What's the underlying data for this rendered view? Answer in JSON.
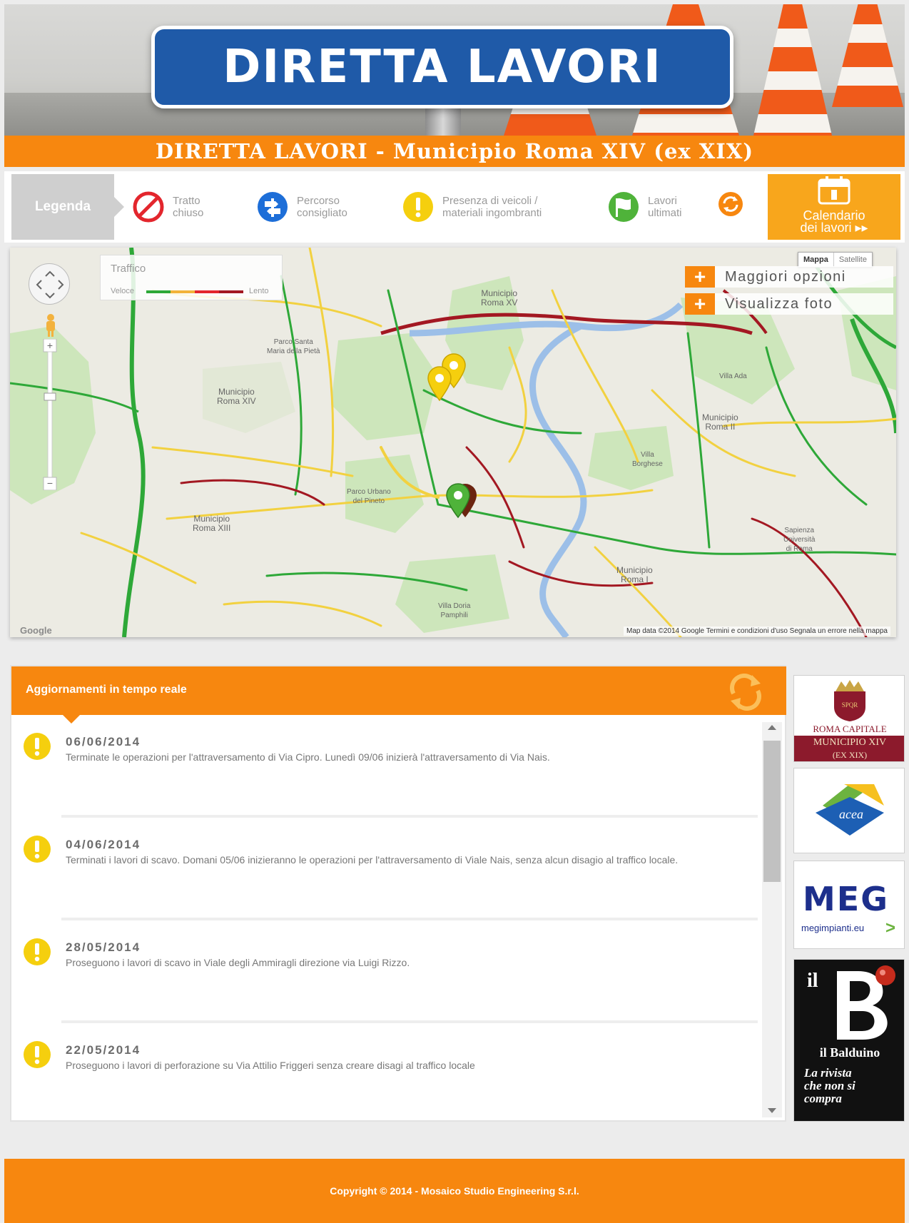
{
  "header": {
    "sign_text": "DIRETTA LAVORI",
    "title": "DIRETTA LAVORI - Municipio Roma XIV (ex XIX)"
  },
  "legend": {
    "label": "Legenda",
    "items": [
      {
        "label": "Tratto\nchiuso",
        "icon": "no-entry-icon",
        "color": "#e3262d"
      },
      {
        "label": "Percorso\nconsigliato",
        "icon": "signpost-icon",
        "color": "#1d6ed8"
      },
      {
        "label": "Presenza di veicoli /\nmateriali ingombranti",
        "icon": "warning-icon",
        "color": "#f5cf0e"
      },
      {
        "label": "Lavori\nultimati",
        "icon": "flag-icon",
        "color": "#4fb33a"
      },
      {
        "label": "",
        "icon": "refresh-icon",
        "color": "#f7870f"
      }
    ],
    "calendar_button": "Calendario\ndei lavori ▸▸"
  },
  "map": {
    "traffic_title": "Traffico",
    "traffic_fast": "Veloce",
    "traffic_slow": "Lento",
    "map_type_active": "Mappa",
    "map_type_inactive": "Satellite",
    "more_options": "Maggiori opzioni",
    "view_photo": "Visualizza foto",
    "footer": "Map data ©2014 Google   Termini e condizioni d'uso   Segnala un errore nella mappa",
    "google": "Google",
    "labels": {
      "mun_xv": "Municipio\nRoma XV",
      "mun_xiv": "Municipio\nRoma XIV",
      "mun_ii": "Municipio\nRoma II",
      "mun_i": "Municipio\nRoma I",
      "mun_xiii": "Municipio\nRoma XIII",
      "parco_santa_maria": "Parco Santa\nMaria della Pietà",
      "parco_pineto": "Parco Urbano\ndel Pineto",
      "villa_borghese": "Villa\nBorghese",
      "villa_doria": "Villa Doria\nPamphili",
      "villa_ada": "Villa Ada",
      "sapienza": "Sapienza\nUniversità\ndi Roma"
    }
  },
  "updates": {
    "title": "Aggiornamenti in tempo reale",
    "items": [
      {
        "date": "06/06/2014",
        "text": "Terminate le operazioni per l'attraversamento di Via Cipro. Lunedì 09/06 inizierà l'attraversamento di Via Nais."
      },
      {
        "date": "04/06/2014",
        "text": "Terminati i lavori di scavo. Domani 05/06 inizieranno le operazioni per l'attraversamento di Viale Nais, senza alcun disagio al traffico locale."
      },
      {
        "date": "28/05/2014",
        "text": "Proseguono i lavori di scavo in Viale degli Ammiragli direzione via Luigi Rizzo."
      },
      {
        "date": "22/05/2014",
        "text": "Proseguono i lavori di perforazione su Via Attilio Friggeri senza creare disagi al traffico locale"
      }
    ]
  },
  "sponsors": {
    "roma_top": "ROMA CAPITALE",
    "roma_mun": "MUNICIPIO XIV",
    "roma_ex": "(EX XIX)",
    "acea": "acea",
    "meg_logo": "MEG",
    "meg_url": "megimpianti.eu",
    "balduino_name": "il Balduino",
    "balduino_slogan": "La rivista\nche non si\ncompra",
    "balduino_mark": "il"
  },
  "footer": {
    "copyright": "Copyright © 2014 - Mosaico Studio Engineering S.r.l."
  },
  "colors": {
    "orange": "#f7870f",
    "sign_blue": "#1f5aa8",
    "warning_yellow": "#f5cf0e",
    "done_green": "#4fb33a"
  }
}
